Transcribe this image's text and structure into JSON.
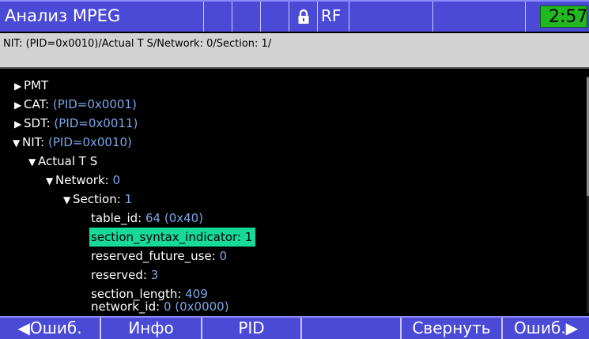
{
  "header": {
    "title": "Анализ MPEG",
    "lock_icon": "lock-icon",
    "rf_label": "RF",
    "clock": "2:57",
    "clock_color": "#22b822",
    "bar_color": "#4a4ad6"
  },
  "path": "NIT: (PID=0x0010)/Actual T S/Network: 0/Section: 1/",
  "tree": [
    {
      "label": "PMT",
      "value": "",
      "expanded": false
    },
    {
      "label": "CAT:",
      "value": "(PID=0x0001)",
      "expanded": false
    },
    {
      "label": "SDT:",
      "value": "(PID=0x0011)",
      "expanded": false
    },
    {
      "label": "NIT:",
      "value": "(PID=0x0010)",
      "expanded": true
    },
    {
      "label": "Actual T S",
      "value": "",
      "expanded": true
    },
    {
      "label": "Network:",
      "value": "0",
      "expanded": true
    },
    {
      "label": "Section:",
      "value": "1",
      "expanded": true
    },
    {
      "label": "table_id:",
      "value": "64 (0x40)"
    },
    {
      "label": "section_syntax_indicator:",
      "value": "1",
      "selected": true
    },
    {
      "label": "reserved_future_use:",
      "value": "0"
    },
    {
      "label": "reserved:",
      "value": "3"
    },
    {
      "label": "section_length:",
      "value": "409"
    },
    {
      "label": "network_id:",
      "value": "0 (0x0000)"
    }
  ],
  "softkeys": {
    "prev_error": "Ошиб.",
    "info": "Инфо",
    "pid": "PID",
    "empty": "",
    "collapse": "Свернуть",
    "next_error": "Ошиб."
  },
  "highlight_color": "#16d99a"
}
